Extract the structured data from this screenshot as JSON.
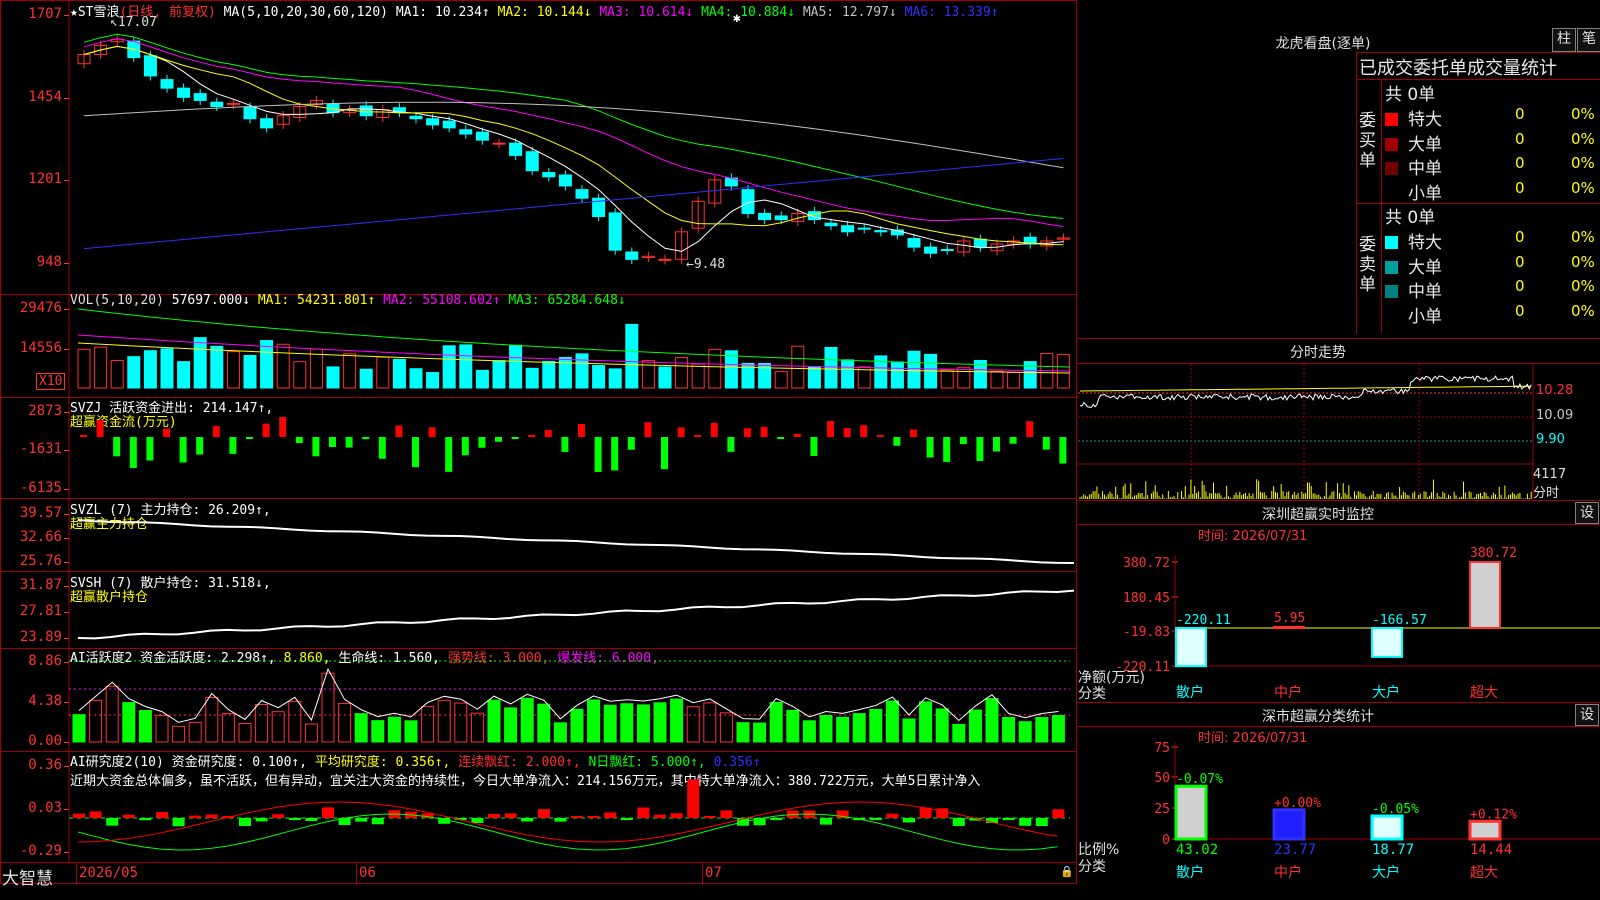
{
  "main": {
    "stock_name": "★ST雪浪",
    "period": "(日线, 前复权)",
    "ma_params": "MA(5,10,20,30,60,120)",
    "ma_items": [
      {
        "text": "MA1: 10.234↑",
        "color": "#ffffff"
      },
      {
        "text": "MA2: 10.144↓",
        "color": "#ffff00"
      },
      {
        "text": "MA3: 10.614↓",
        "color": "#ff00ff"
      },
      {
        "text": "MA4: 10.884↓",
        "color": "#00ff00"
      },
      {
        "text": "MA5: 12.797↓",
        "color": "#c0c0c0"
      },
      {
        "text": "MA6: 13.339↑",
        "color": "#3030ff"
      }
    ],
    "high_marker": "17.07",
    "low_marker": "←9.48",
    "y_ticks": [
      "1707",
      "1454",
      "1201",
      "948"
    ]
  },
  "vol": {
    "params": "VOL(5,10,20)",
    "value": "57697.000↓",
    "items": [
      {
        "text": "MA1: 54231.801↑",
        "color": "#ffff00"
      },
      {
        "text": "MA2: 55108.602↑",
        "color": "#ff00ff"
      },
      {
        "text": "MA3: 65284.648↓",
        "color": "#00ff00"
      }
    ],
    "y_ticks": [
      "29476",
      "14556"
    ],
    "unit": "X10"
  },
  "svzj": {
    "title": "SVZJ  活跃资金进出: 214.147↑,",
    "subtitle": "超赢资金流(万元)",
    "y_ticks": [
      "2873",
      "-1631",
      "-6135"
    ]
  },
  "svzl": {
    "title": "SVZL (7) 主力持仓: 26.209↑,",
    "subtitle": "超赢主力持仓",
    "y_ticks": [
      "39.57",
      "32.66",
      "25.76"
    ]
  },
  "svsh": {
    "title": "SVSH (7) 散户持仓: 31.518↓,",
    "subtitle": "超赢散户持仓",
    "y_ticks": [
      "31.87",
      "27.81",
      "23.89"
    ]
  },
  "ai_active": {
    "title": "AI活跃度2 资金活跃度: 2.298↑,",
    "v2": "8.860,",
    "v3": "生命线: 1.560,",
    "v4": "强势线: 3.000,",
    "v5": "爆发线: 6.000,",
    "y_ticks": [
      "8.86",
      "4.38",
      "0.00"
    ]
  },
  "ai_research": {
    "title": "AI研究度2(10) 资金研究度: 0.100↑,",
    "v2": "平均研究度: 0.356↑,",
    "v3": "连续飘红: 2.000↑,",
    "v4": "N日飘红: 5.000↑,",
    "v5": "0.356↑",
    "comment": "近期大资金总体偏多，虽不活跃，但有异动，宜关注大资金的持续性，今日大单净流入：214.156万元，其中特大单净流入：380.722万元，大单5日累计净入",
    "y_ticks": [
      "0.36",
      "0.03",
      "-0.29"
    ]
  },
  "bottom_bar": {
    "brand": "大智慧",
    "dates": [
      "2026/05",
      "06",
      "07"
    ]
  },
  "lhb": {
    "title": "龙虎看盘(逐单)",
    "btn1": "柱",
    "btn2": "笔",
    "header": "已成交委托单成交量统计",
    "buy_label": "委买单",
    "sell_label": "委卖单",
    "buy_total": "共 0单",
    "sell_total": "共 0单",
    "buy_rows": [
      {
        "name": "特大",
        "count": "0",
        "pct": "0%",
        "color": "#ff0000"
      },
      {
        "name": "大单",
        "count": "0",
        "pct": "0%",
        "color": "#a00000"
      },
      {
        "name": "中单",
        "count": "0",
        "pct": "0%",
        "color": "#700000"
      },
      {
        "name": "小单",
        "count": "0",
        "pct": "0%",
        "color": ""
      }
    ],
    "sell_rows": [
      {
        "name": "特大",
        "count": "0",
        "pct": "0%",
        "color": "#00ffff"
      },
      {
        "name": "大单",
        "count": "0",
        "pct": "0%",
        "color": "#00a0a0"
      },
      {
        "name": "中单",
        "count": "0",
        "pct": "0%",
        "color": "#008080"
      },
      {
        "name": "小单",
        "count": "0",
        "pct": "0%",
        "color": ""
      }
    ]
  },
  "fenshi": {
    "title": "分时走势",
    "prices": [
      "10.28",
      "10.09",
      "9.90"
    ],
    "vol_label": "4117",
    "vol_label2": "分时"
  },
  "sz_monitor": {
    "title": "深圳超赢实时监控",
    "btn": "设",
    "time": "时间: 2026/07/31",
    "y_ticks": [
      "380.72",
      "180.45",
      "-19.83",
      "-220.11"
    ],
    "axis_label1": "净额(万元)",
    "axis_label2": "分类",
    "bars": [
      {
        "cat": "散户",
        "value": "-220.11"
      },
      {
        "cat": "中户",
        "value": "5.95"
      },
      {
        "cat": "大户",
        "value": "-166.57"
      },
      {
        "cat": "超大",
        "value": "380.72"
      }
    ]
  },
  "sz_class": {
    "title": "深市超赢分类统计",
    "btn": "设",
    "time": "时间: 2026/07/31",
    "y_ticks": [
      "75",
      "50",
      "25",
      "0"
    ],
    "axis_label1": "比例%",
    "axis_label2": "分类",
    "bars": [
      {
        "cat": "散户",
        "value": "43.02",
        "delta": "-0.07%"
      },
      {
        "cat": "中户",
        "value": "23.77",
        "delta": "+0.00%"
      },
      {
        "cat": "大户",
        "value": "18.77",
        "delta": "-0.05%"
      },
      {
        "cat": "超大",
        "value": "14.44",
        "delta": "+0.12%"
      }
    ]
  },
  "colors": {
    "up": "#ff3030",
    "down": "#00ffff",
    "frame": "#a00000",
    "green": "#00ff00"
  }
}
